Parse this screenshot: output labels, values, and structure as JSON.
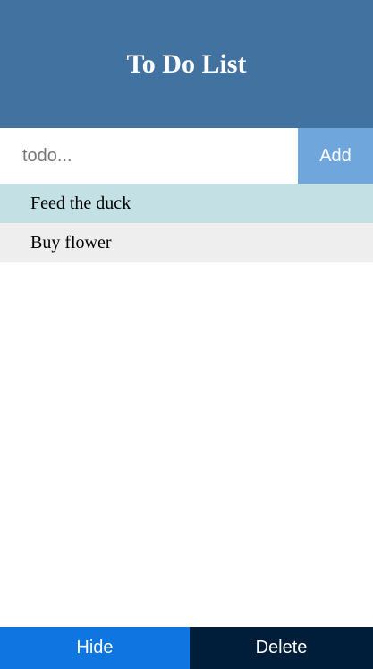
{
  "header": {
    "title": "To Do List"
  },
  "input": {
    "value": "",
    "placeholder": "todo...",
    "add_label": "Add"
  },
  "todos": [
    {
      "label": "Feed the duck",
      "state": "highlighted"
    },
    {
      "label": "Buy flower",
      "state": "normal"
    }
  ],
  "footer": {
    "hide_label": "Hide",
    "delete_label": "Delete"
  },
  "colors": {
    "header_bg": "#4272a0",
    "add_bg": "#6fa7dc",
    "highlighted_item_bg": "#c3e1e5",
    "item_bg": "#eeeeee",
    "hide_bg": "#0f75e0",
    "delete_bg": "#001d3a"
  }
}
